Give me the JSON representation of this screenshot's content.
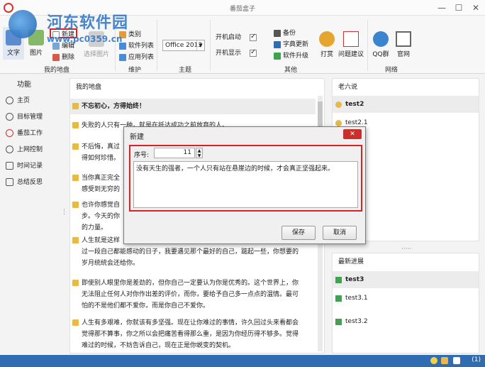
{
  "window": {
    "title": "番茄盒子"
  },
  "watermark": {
    "line1": "河东软件园",
    "line2": "www.pc0359.cn"
  },
  "ribbon": {
    "wenzi": "文字",
    "tupian": "图片",
    "xinjian": "新建",
    "bianji": "编辑",
    "shanchu": "删除",
    "xuanze_tupian": "选择图片",
    "leibie": "类别",
    "ruanjian_liebiao": "软件列表",
    "yingyong_liebiao": "应用列表",
    "theme_value": "Office 2013",
    "kaiji_qidong": "开机启动",
    "kaiji_xianshi": "开机显示",
    "beifen": "备份",
    "zidian_gengxin": "字典更新",
    "ruanjian_shengji": "软件升级",
    "dashang": "打赏",
    "wenti_jianyi": "问题建议",
    "qq_qun": "QQ群",
    "guanwang": "官网",
    "groups": {
      "mydiliang": "我的地盘",
      "weihu": "维护",
      "zhuti": "主题",
      "qita": "其他",
      "wangluo": "网络"
    }
  },
  "leftnav": {
    "head": "功能",
    "items": [
      {
        "label": "主页"
      },
      {
        "label": "目标管理"
      },
      {
        "label": "番茄工作"
      },
      {
        "label": "上网控制"
      },
      {
        "label": "时间记录"
      },
      {
        "label": "总结反思"
      }
    ]
  },
  "main": {
    "title": "我的地盘",
    "quotes": [
      "不忘初心，方得始终！",
      "失败的人只有一种，就是在抵达成功之前放弃的人。",
      "不后悔，真过",
      "得如何珍惜。",
      "当你真正完全",
      "感受到无穷的",
      "也许你感觉自",
      "步。今天的你",
      "的力量。",
      "人生就是这样",
      "过一段自己都能感动的日子，我要遇见那个最好的自己，踮起一些，你想要的",
      "岁月统统会还给你。",
      "即使别人眼里你是差劲的，但你自己一定要认为你是优秀的。这个世界上，你",
      "无法阻止任何人对你作出差的评价，而你，要给予自己多一点点的温情。最可",
      "怕的不是他们都不爱你，而是你自己不爱你。",
      "人生有多艰难，你就该有多坚强。现在让你难过的事情，许久回过头来看都会",
      "觉得那不算事，你之所以会把痛苦看得那么重，是因为你经历得不够多。觉得",
      "难过的时候，不妨告诉自己，现在正是你蜕变的契机。"
    ]
  },
  "right_top": {
    "title": "老六说",
    "items": [
      {
        "label": "test2"
      },
      {
        "label": "test2.1"
      }
    ]
  },
  "right_bottom": {
    "title": "最新进展",
    "items": [
      {
        "label": "test3"
      },
      {
        "label": "test3.1"
      },
      {
        "label": "test3.2"
      }
    ]
  },
  "dialog": {
    "title": "新建",
    "seq_label": "序号:",
    "seq_value": "11",
    "quote_text": "没有天生的强者，一个人只有站在悬崖边的时候，才会真正坚强起来。",
    "save_label": "保存",
    "cancel_label": "取消"
  },
  "statusbar": {
    "text": "(1)"
  },
  "colors": {
    "accent": "#2f6cb1",
    "highlight_red": "#d62424",
    "note_yellow": "#e7b84a"
  }
}
